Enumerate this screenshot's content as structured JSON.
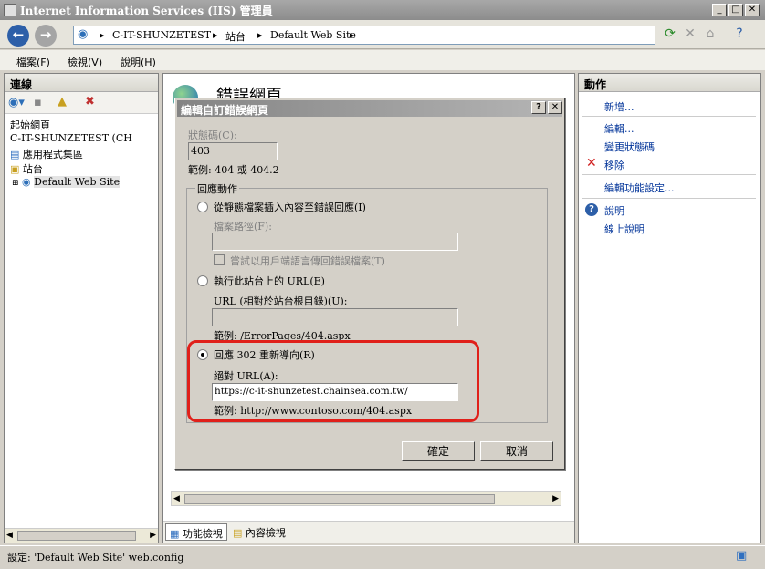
{
  "window": {
    "title": "Internet Information Services (IIS) 管理員"
  },
  "address": {
    "crumbs": [
      "C-IT-SHUNZETEST",
      "站台",
      "Default Web Site"
    ]
  },
  "menu": {
    "items": [
      "檔案(F)",
      "檢視(V)",
      "說明(H)"
    ]
  },
  "left_pane": {
    "header": "連線",
    "tree": {
      "start_page": "起始網頁",
      "server": "C-IT-SHUNZETEST (CH",
      "app_pools": "應用程式集區",
      "sites": "站台",
      "default_site": "Default Web Site"
    }
  },
  "center": {
    "feature_title": "錯誤網頁",
    "tabs": {
      "features": "功能檢視",
      "content": "內容檢視"
    }
  },
  "right_pane": {
    "header": "動作",
    "actions": {
      "add": "新增...",
      "edit": "編輯...",
      "change_status": "變更狀態碼",
      "remove": "移除",
      "edit_feature": "編輯功能設定...",
      "help": "說明",
      "online_help": "線上說明"
    }
  },
  "status": {
    "text": "設定: 'Default Web Site' web.config"
  },
  "dialog": {
    "title": "編輯自訂錯誤網頁",
    "status_code_label": "狀態碼(C):",
    "status_code_value": "403",
    "status_example": "範例: 404 或 404.2",
    "group_label": "回應動作",
    "opt_file": "從靜態檔案插入內容至錯誤回應(I)",
    "file_path_label": "檔案路徑(F):",
    "file_path_value": "",
    "try_locale": "嘗試以用戶端語言傳回錯誤檔案(T)",
    "opt_url": "執行此站台上的 URL(E)",
    "url_label": "URL (相對於站台根目錄)(U):",
    "url_value": "",
    "url_example": "範例: /ErrorPages/404.aspx",
    "opt_redirect": "回應 302 重新導向(R)",
    "abs_url_label": "絕對 URL(A):",
    "abs_url_value": "https://c-it-shunzetest.chainsea.com.tw/",
    "abs_url_example": "範例: http://www.contoso.com/404.aspx",
    "ok": "確定",
    "cancel": "取消",
    "selected_option": "redirect"
  }
}
